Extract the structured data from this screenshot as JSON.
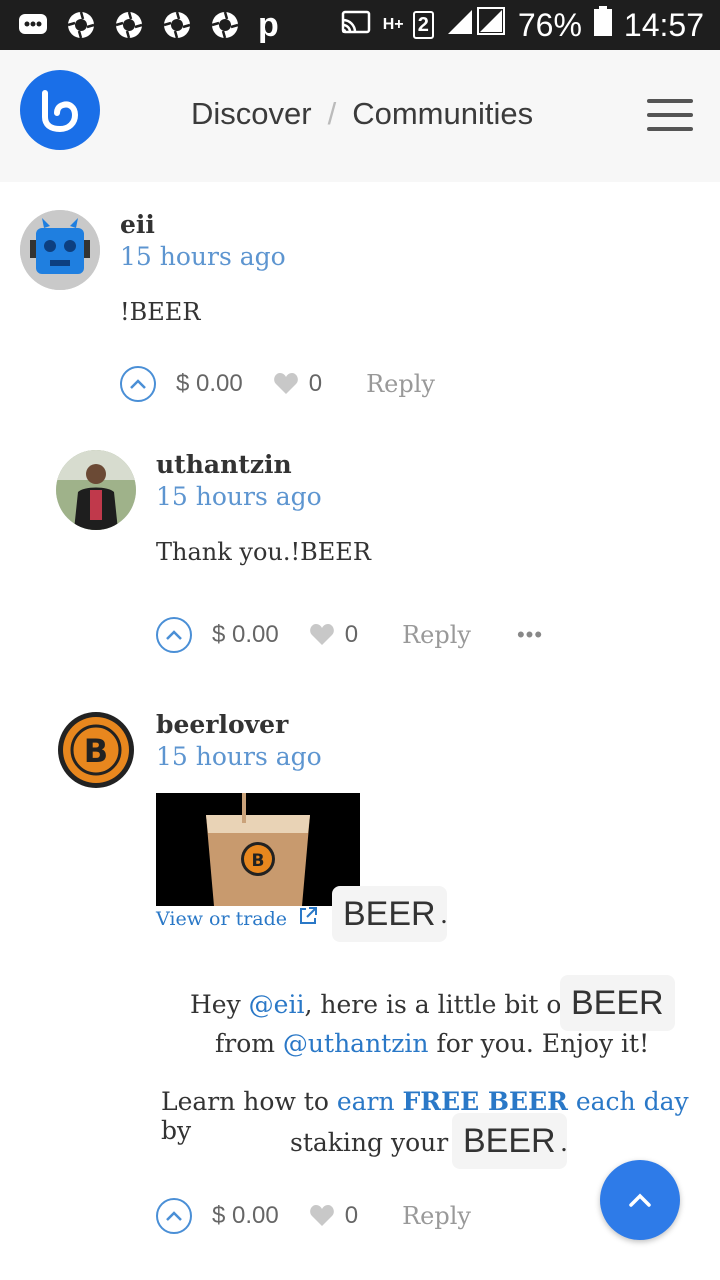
{
  "status_bar": {
    "battery": "76%",
    "time": "14:57",
    "network": "H+",
    "sim": "2",
    "app_letter": "p"
  },
  "header": {
    "nav_discover": "Discover",
    "nav_sep": "/",
    "nav_communities": "Communities"
  },
  "comments": [
    {
      "author": "eii",
      "time": "15 hours ago",
      "body": "!BEER",
      "payout": "$ 0.00",
      "likes": "0",
      "reply": "Reply"
    },
    {
      "author": "uthantzin",
      "time": "15 hours ago",
      "body": "Thank you.!BEER",
      "payout": "$ 0.00",
      "likes": "0",
      "reply": "Reply",
      "more": "•••"
    },
    {
      "author": "beerlover",
      "time": "15 hours ago",
      "view_trade": "View or trade",
      "token_chip": "BEER",
      "period": ".",
      "line1_pre": "Hey ",
      "line1_mention": "@eii",
      "line1_post": ", here is a little bit of ",
      "line1_chip": "BEER",
      "line2_pre": "from ",
      "line2_mention": "@uthantzin",
      "line2_post": " for you. Enjoy it!",
      "line3_pre": "Learn how to ",
      "line3_link1": "earn ",
      "line3_link_bold": "FREE BEER",
      "line3_link2": " each day",
      "line3_post": " by",
      "line4_pre": "staking your ",
      "line4_chip": "BEER",
      "line4_post": ".",
      "payout": "$ 0.00",
      "likes": "0",
      "reply": "Reply"
    }
  ],
  "colors": {
    "accent": "#1a6fe8",
    "link": "#2a78c7",
    "time": "#5d95d0"
  }
}
